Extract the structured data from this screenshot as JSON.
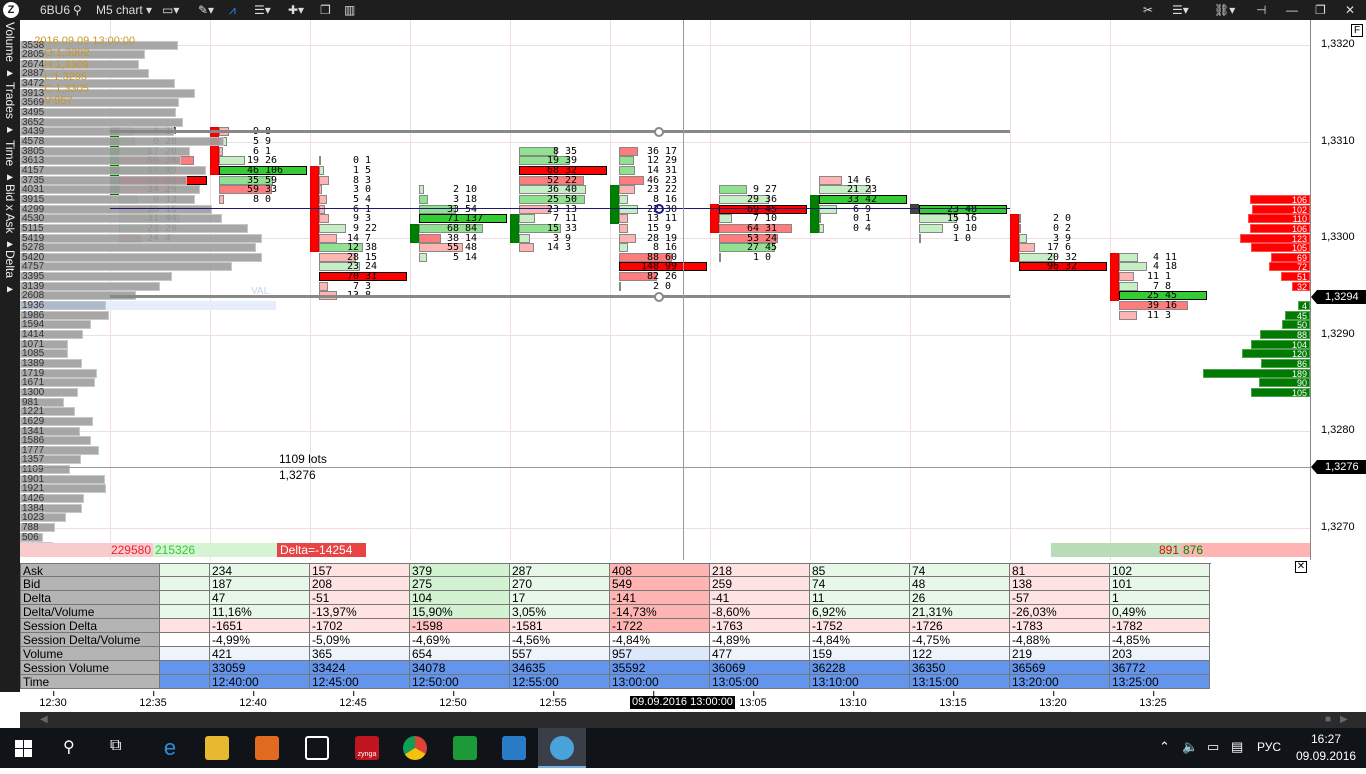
{
  "toolbar": {
    "symbol": "6BU6",
    "chart_type": "M5 chart",
    "accent": "#1e90ff"
  },
  "left_tabs": [
    "Volume",
    "Trades",
    "Time",
    "Bid x Ask",
    "Delta"
  ],
  "info": {
    "datetime": "2016.09.09 13:00:00",
    "open": "O:1,3302",
    "high": "H:1,3309",
    "low": "L:1,3295",
    "close": "C:1,3305",
    "volume": "V:957"
  },
  "price_axis": {
    "top_price": 1.332,
    "tick": 0.0001,
    "labels": [
      {
        "text": "1,3320",
        "price": 1.332
      },
      {
        "text": "1,3310",
        "price": 1.331
      },
      {
        "text": "1,3300",
        "price": 1.33
      },
      {
        "text": "1,3290",
        "price": 1.329
      },
      {
        "text": "1,3280",
        "price": 1.328
      },
      {
        "text": "1,3270",
        "price": 1.327
      }
    ],
    "current_price": "1,3294",
    "crosshair_price": "1,3276",
    "f_button": "F"
  },
  "volume_profile": {
    "max": 5420,
    "val_label": "VAL",
    "val_index": 27,
    "values": [
      3538,
      2805,
      2674,
      2887,
      3472,
      3913,
      3569,
      3495,
      3652,
      3439,
      4578,
      3805,
      3613,
      4157,
      3735,
      4031,
      3915,
      4299,
      4530,
      5115,
      5419,
      5278,
      5420,
      4757,
      3395,
      3139,
      2608,
      1936,
      1986,
      1594,
      1414,
      1071,
      1085,
      1389,
      1719,
      1671,
      1300,
      981,
      1221,
      1629,
      1341,
      1586,
      1777,
      1357,
      1109,
      1901,
      1921,
      1426,
      1384,
      1023,
      788,
      506,
      732
    ]
  },
  "footprint": [
    {
      "time": "12:35",
      "open": 1.3305,
      "close": 1.3311,
      "start_price": 1.3311,
      "cells": [
        [
          4,
          14
        ],
        [
          0,
          20
        ],
        [
          17,
          20
        ],
        [
          56,
          38
        ],
        [
          17,
          49
        ],
        [
          65,
          45
        ],
        [
          34,
          29
        ],
        [
          9,
          13
        ],
        [
          28,
          15
        ],
        [
          31,
          44
        ],
        [
          21,
          29
        ],
        [
          24,
          4
        ]
      ]
    },
    {
      "time": "12:40",
      "open": 1.3311,
      "close": 1.3307,
      "start_price": 1.3311,
      "cells": [
        [
          9,
          8
        ],
        [
          5,
          9
        ],
        [
          6,
          1
        ],
        [
          19,
          26
        ],
        [
          46,
          106
        ],
        [
          35,
          59
        ],
        [
          59,
          33
        ],
        [
          8,
          0
        ]
      ]
    },
    {
      "time": "12:45",
      "open": 1.3307,
      "close": 1.3299,
      "start_price": 1.3308,
      "cells": [
        [
          0,
          1
        ],
        [
          1,
          5
        ],
        [
          8,
          3
        ],
        [
          3,
          0
        ],
        [
          5,
          4
        ],
        [
          6,
          1
        ],
        [
          9,
          3
        ],
        [
          9,
          22
        ],
        [
          14,
          7
        ],
        [
          12,
          38
        ],
        [
          28,
          15
        ],
        [
          23,
          24
        ],
        [
          70,
          31
        ],
        [
          7,
          3
        ],
        [
          13,
          8
        ]
      ]
    },
    {
      "time": "12:50",
      "open": 1.33,
      "close": 1.3301,
      "start_price": 1.3305,
      "cells": [
        [
          2,
          10
        ],
        [
          3,
          18
        ],
        [
          33,
          54
        ],
        [
          71,
          137
        ],
        [
          68,
          84
        ],
        [
          38,
          14
        ],
        [
          55,
          48
        ],
        [
          5,
          14
        ]
      ]
    },
    {
      "time": "12:55",
      "open": 1.33,
      "close": 1.3302,
      "start_price": 1.3309,
      "cells": [
        [
          8,
          35
        ],
        [
          19,
          39
        ],
        [
          68,
          32
        ],
        [
          52,
          22
        ],
        [
          36,
          40
        ],
        [
          25,
          50
        ],
        [
          23,
          13
        ],
        [
          7,
          11
        ],
        [
          15,
          33
        ],
        [
          3,
          9
        ],
        [
          14,
          3
        ]
      ]
    },
    {
      "time": "13:00",
      "open": 1.3302,
      "close": 1.3305,
      "start_price": 1.3309,
      "cells": [
        [
          36,
          17
        ],
        [
          12,
          29
        ],
        [
          14,
          31
        ],
        [
          46,
          23
        ],
        [
          23,
          22
        ],
        [
          8,
          16
        ],
        [
          22,
          30
        ],
        [
          13,
          11
        ],
        [
          15,
          9
        ],
        [
          28,
          19
        ],
        [
          8,
          16
        ],
        [
          88,
          60
        ],
        [
          148,
          99
        ],
        [
          82,
          26
        ],
        [
          2,
          0
        ]
      ]
    },
    {
      "time": "13:05",
      "open": 1.3303,
      "close": 1.3301,
      "start_price": 1.3305,
      "cells": [
        [
          9,
          27
        ],
        [
          29,
          36
        ],
        [
          69,
          45
        ],
        [
          7,
          10
        ],
        [
          64,
          31
        ],
        [
          53,
          24
        ],
        [
          27,
          45
        ],
        [
          1,
          0
        ]
      ]
    },
    {
      "time": "13:10",
      "open": 1.3301,
      "close": 1.3304,
      "start_price": 1.3306,
      "cells": [
        [
          14,
          6
        ],
        [
          21,
          23
        ],
        [
          33,
          42
        ],
        [
          6,
          9
        ],
        [
          0,
          1
        ],
        [
          0,
          4
        ]
      ]
    },
    {
      "time": "13:15",
      "open": 1.3303,
      "close": 1.3303,
      "start_price": 1.3303,
      "cells": [
        [
          23,
          48
        ],
        [
          15,
          16
        ],
        [
          9,
          10
        ],
        [
          1,
          0
        ]
      ]
    },
    {
      "time": "13:20",
      "open": 1.3302,
      "close": 1.3298,
      "start_price": 1.3302,
      "cells": [
        [
          2,
          0
        ],
        [
          0,
          2
        ],
        [
          3,
          9
        ],
        [
          17,
          6
        ],
        [
          20,
          32
        ],
        [
          96,
          32
        ]
      ]
    },
    {
      "time": "13:25",
      "open": 1.3298,
      "close": 1.3294,
      "start_price": 1.3298,
      "cells": [
        [
          4,
          11
        ],
        [
          4,
          18
        ],
        [
          11,
          1
        ],
        [
          7,
          8
        ],
        [
          25,
          45
        ],
        [
          39,
          16
        ],
        [
          11,
          3
        ]
      ]
    }
  ],
  "dom": {
    "asks_start_price": 1.3304,
    "asks": [
      106,
      102,
      110,
      106,
      123,
      105,
      69,
      72,
      51,
      32
    ],
    "bids_start_price": 1.3293,
    "bids": [
      4,
      45,
      50,
      88,
      104,
      120,
      86,
      189,
      90,
      105
    ],
    "max": 189
  },
  "crosshair": {
    "lots": "1109 lots",
    "price": "1,3276"
  },
  "session_totals": {
    "bid": "229580",
    "ask": "215326",
    "delta": "Delta=-14254"
  },
  "dom_totals": {
    "bid": "891",
    "ask": "876"
  },
  "stats_table": {
    "rows": [
      {
        "label": "Ask",
        "values": [
          "234",
          "157",
          "379",
          "287",
          "408",
          "218",
          "85",
          "74",
          "81",
          "102"
        ]
      },
      {
        "label": "Bid",
        "values": [
          "187",
          "208",
          "275",
          "270",
          "549",
          "259",
          "74",
          "48",
          "138",
          "101"
        ]
      },
      {
        "label": "Delta",
        "values": [
          "47",
          "-51",
          "104",
          "17",
          "-141",
          "-41",
          "11",
          "26",
          "-57",
          "1"
        ]
      },
      {
        "label": "Delta/Volume",
        "values": [
          "11,16%",
          "-13,97%",
          "15,90%",
          "3,05%",
          "-14,73%",
          "-8,60%",
          "6,92%",
          "21,31%",
          "-26,03%",
          "0,49%"
        ]
      },
      {
        "label": "Session Delta",
        "values": [
          "-1651",
          "-1702",
          "-1598",
          "-1581",
          "-1722",
          "-1763",
          "-1752",
          "-1726",
          "-1783",
          "-1782"
        ]
      },
      {
        "label": "Session Delta/Volume",
        "values": [
          "-4,99%",
          "-5,09%",
          "-4,69%",
          "-4,56%",
          "-4,84%",
          "-4,89%",
          "-4,84%",
          "-4,75%",
          "-4,88%",
          "-4,85%"
        ]
      },
      {
        "label": "Volume",
        "values": [
          "421",
          "365",
          "654",
          "557",
          "957",
          "477",
          "159",
          "122",
          "219",
          "203"
        ]
      },
      {
        "label": "Session Volume",
        "values": [
          "33059",
          "33424",
          "34078",
          "34635",
          "35592",
          "36069",
          "36228",
          "36350",
          "36569",
          "36772"
        ]
      },
      {
        "label": "Time",
        "values": [
          "12:40:00",
          "12:45:00",
          "12:50:00",
          "12:55:00",
          "13:00:00",
          "13:05:00",
          "13:10:00",
          "13:15:00",
          "13:20:00",
          "13:25:00"
        ]
      }
    ]
  },
  "time_axis": {
    "labels": [
      "12:30",
      "12:35",
      "12:40",
      "12:45",
      "12:50",
      "12:55",
      "13:00",
      "13:05",
      "13:10",
      "13:15",
      "13:20",
      "13:25"
    ],
    "cursor_label": "09.09.2016 13:00:00"
  },
  "taskbar": {
    "zynga_logo": "zynga",
    "language": "РУС",
    "clock_time": "16:27",
    "clock_date": "09.09.2016"
  }
}
